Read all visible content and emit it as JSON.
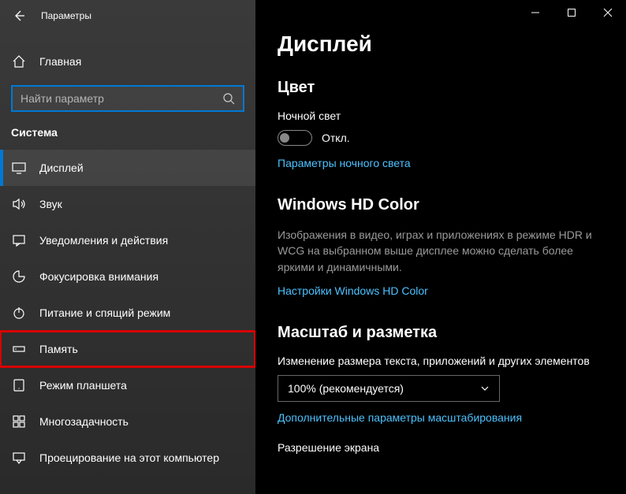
{
  "titlebar": {
    "app_title": "Параметры"
  },
  "home": {
    "label": "Главная"
  },
  "search": {
    "placeholder": "Найти параметр"
  },
  "category": {
    "title": "Система"
  },
  "nav": {
    "items": [
      {
        "label": "Дисплей"
      },
      {
        "label": "Звук"
      },
      {
        "label": "Уведомления и действия"
      },
      {
        "label": "Фокусировка внимания"
      },
      {
        "label": "Питание и спящий режим"
      },
      {
        "label": "Память"
      },
      {
        "label": "Режим планшета"
      },
      {
        "label": "Многозадачность"
      },
      {
        "label": "Проецирование на этот компьютер"
      }
    ]
  },
  "main": {
    "title": "Дисплей",
    "color": {
      "heading": "Цвет",
      "night_light_label": "Ночной свет",
      "toggle_state": "Откл.",
      "link": "Параметры ночного света"
    },
    "hd": {
      "heading": "Windows HD Color",
      "desc": "Изображения в видео, играх и приложениях в режиме HDR и WCG на выбранном выше дисплее можно сделать более яркими и динамичными.",
      "link": "Настройки Windows HD Color"
    },
    "scale": {
      "heading": "Масштаб и разметка",
      "text_size_label": "Изменение размера текста, приложений и других элементов",
      "select_value": "100% (рекомендуется)",
      "adv_link": "Дополнительные параметры масштабирования",
      "resolution_label": "Разрешение экрана"
    }
  }
}
